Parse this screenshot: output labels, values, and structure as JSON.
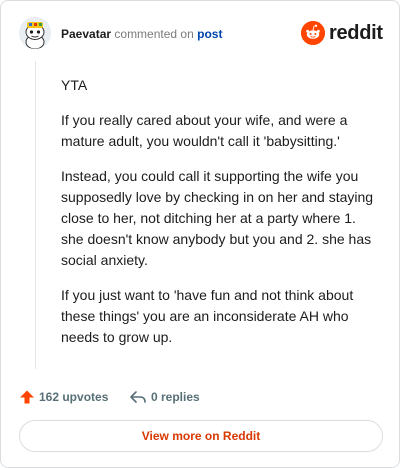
{
  "header": {
    "author": "Paevatar",
    "action": "commented on",
    "target": "post",
    "logo_text": "reddit"
  },
  "comment": {
    "paragraphs": [
      "YTA",
      "If you really cared about your wife, and were a mature adult, you wouldn't call it 'babysitting.'",
      "Instead, you could call it supporting the wife you supposedly love by checking in on her and staying close to her, not ditching her at a party where 1. she doesn't know anybody but you and 2. she has social anxiety.",
      "If you just want to 'have fun and not think about these things' you are an inconsiderate AH who needs to grow up."
    ]
  },
  "stats": {
    "upvotes": "162 upvotes",
    "replies": "0 replies"
  },
  "footer": {
    "view_more": "View more on Reddit"
  },
  "colors": {
    "brand": "#ff4500",
    "link": "#0045ac",
    "cta": "#d93900",
    "muted": "#576f76"
  },
  "icons": {
    "avatar": "snoo-avatar",
    "logo": "reddit-logo-icon",
    "upvote": "upvote-arrow-icon",
    "reply": "reply-arrow-icon"
  }
}
